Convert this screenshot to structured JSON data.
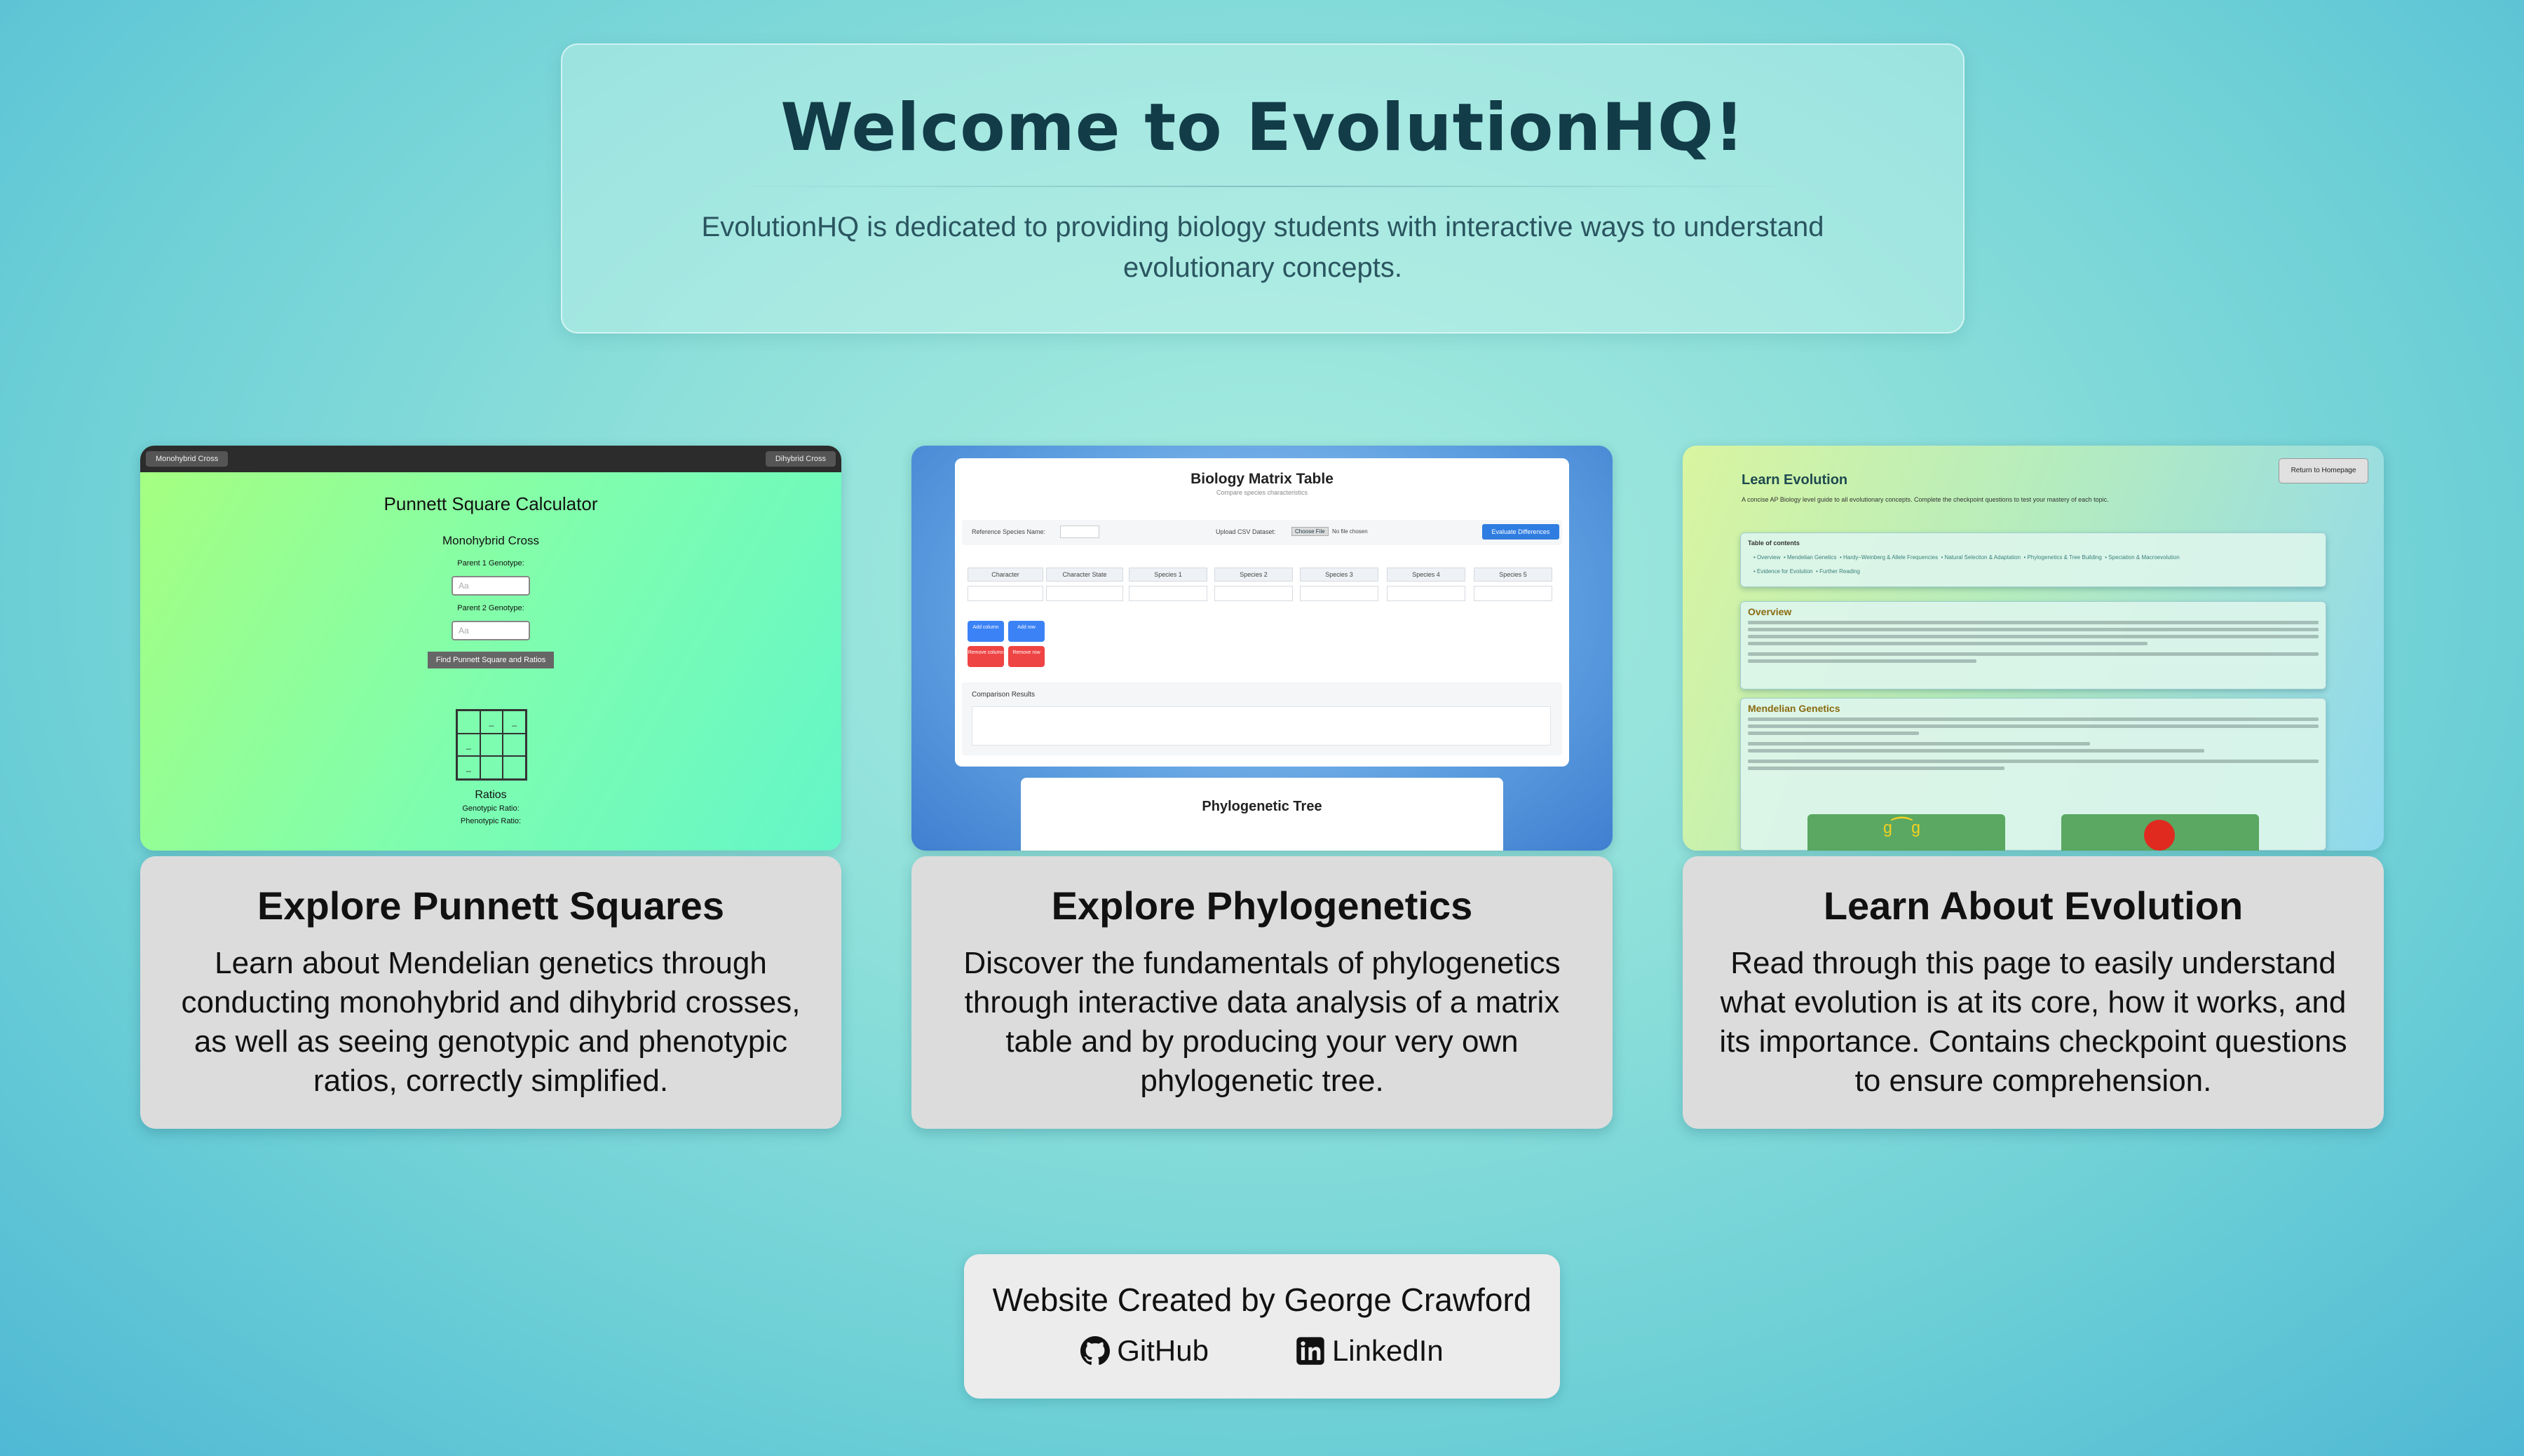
{
  "hero": {
    "title": "Welcome to EvolutionHQ!",
    "subtitle": "EvolutionHQ is dedicated to providing biology students with interactive ways to understand evolutionary concepts."
  },
  "cards": [
    {
      "title": "Explore Punnett Squares",
      "description": "Learn about Mendelian genetics through conducting monohybrid and dihybrid crosses, as well as seeing genotypic and phenotypic ratios, correctly simplified.",
      "preview": {
        "left_tab": "Monohybrid Cross",
        "right_tab": "Dihybrid Cross",
        "title": "Punnett Square Calculator",
        "subtitle": "Monohybrid Cross",
        "parent1_label": "Parent 1 Genotype:",
        "parent1_placeholder": "Aa",
        "parent2_label": "Parent 2 Genotype:",
        "parent2_placeholder": "Aa",
        "button": "Find Punnett Square and Ratios",
        "ratios_title": "Ratios",
        "genotypic": "Genotypic Ratio:",
        "phenotypic": "Phenotypic Ratio:"
      }
    },
    {
      "title": "Explore Phylogenetics",
      "description": "Discover the fundamentals of phylogenetics through interactive data analysis of a matrix table and by producing your very own phylogenetic tree.",
      "preview": {
        "title": "Biology Matrix Table",
        "subtitle": "Compare species characteristics",
        "ref_label": "Reference Species Name:",
        "upload_label": "Upload CSV Dataset:",
        "choose_file": "Choose File",
        "no_file": "No file chosen",
        "evaluate": "Evaluate Differences",
        "headers": [
          "Character",
          "Character State",
          "Species 1",
          "Species 2",
          "Species 3",
          "Species 4",
          "Species 5"
        ],
        "add_column": "Add column",
        "add_row": "Add row",
        "remove_column": "Remove column",
        "remove_row": "Remove row",
        "comparison": "Comparison Results",
        "tree_title": "Phylogenetic Tree"
      }
    },
    {
      "title": "Learn About Evolution",
      "description": "Read through this page to easily understand what evolution is at its core, how it works, and its importance. Contains checkpoint questions to ensure comprehension.",
      "preview": {
        "title": "Learn Evolution",
        "return_button": "Return to Homepage",
        "intro": "A concise AP Biology level guide to all evolutionary concepts. Complete the checkpoint questions to test your mastery of each topic.",
        "toc_title": "Table of contents",
        "toc": [
          "Overview",
          "Mendelian Genetics",
          "Hardy–Weinberg & Allele Frequencies",
          "Natural Selection & Adaptation",
          "Phylogenetics & Tree Building",
          "Speciation & Macroevolution",
          "Evidence for Evolution",
          "Further Reading"
        ],
        "overview_title": "Overview",
        "mendel_title": "Mendelian Genetics"
      }
    }
  ],
  "footer": {
    "credit": "Website Created by George Crawford",
    "github": "GitHub",
    "linkedin": "LinkedIn"
  }
}
